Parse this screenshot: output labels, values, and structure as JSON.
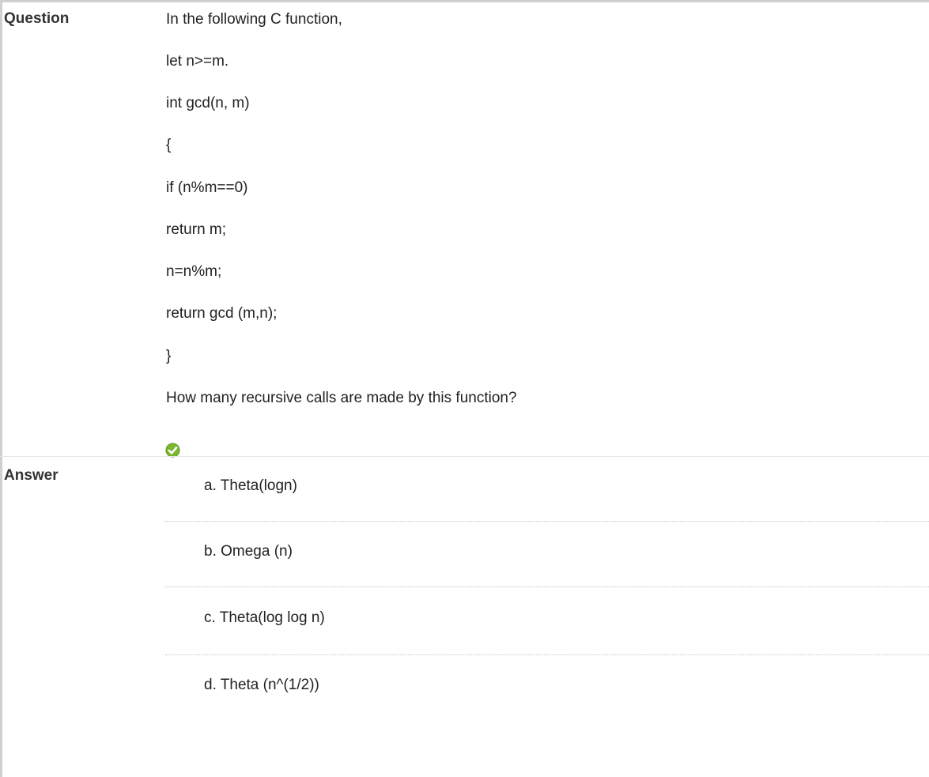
{
  "question": {
    "label": "Question",
    "lines": [
      "In the following C function,",
      "let n>=m.",
      "int gcd(n, m)",
      "{",
      "if (n%m==0)",
      "return m;",
      "n=n%m;",
      "return gcd (m,n);",
      "}",
      "How many recursive calls are made by this function?"
    ]
  },
  "status_icon": "check-icon",
  "answer": {
    "label": "Answer",
    "options": [
      "a. Theta(logn)",
      "b. Omega (n)",
      "c. Theta(log log n)",
      "d. Theta (n^(1/2))"
    ]
  },
  "colors": {
    "border": "#d0d0d0",
    "check_green": "#7cb82f"
  }
}
